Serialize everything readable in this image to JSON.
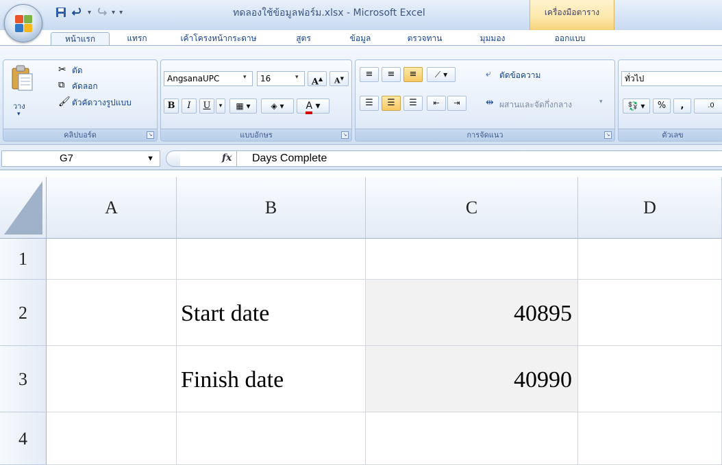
{
  "window": {
    "title": "ทดลองใช้ข้อมูลฟอร์ม.xlsx - Microsoft Excel",
    "contextual_tab": "เครื่องมือตาราง"
  },
  "quick_access": {
    "icons": [
      "save-icon",
      "undo-icon",
      "redo-icon",
      "customize-dropdown-icon"
    ]
  },
  "tabs": [
    {
      "label": "หน้าแรก",
      "active": true
    },
    {
      "label": "แทรก"
    },
    {
      "label": "เค้าโครงหน้ากระดาษ"
    },
    {
      "label": "สูตร"
    },
    {
      "label": "ข้อมูล"
    },
    {
      "label": "ตรวจทาน"
    },
    {
      "label": "มุมมอง"
    },
    {
      "label": "ออกแบบ"
    }
  ],
  "ribbon": {
    "clipboard": {
      "label": "คลิปบอร์ด",
      "paste": "วาง",
      "cut": "ตัด",
      "copy": "คัดลอก",
      "format_painter": "ตัวคัดวางรูปแบบ"
    },
    "font": {
      "label": "แบบอักษร",
      "font_name": "AngsanaUPC",
      "font_size": "16",
      "bold": "B",
      "italic": "I",
      "underline": "U"
    },
    "alignment": {
      "label": "การจัดแนว",
      "wrap_text": "ตัดข้อความ",
      "merge_center": "ผสานและจัดกึ่งกลาง"
    },
    "number": {
      "label": "ตัวเลข",
      "format": "ทั่วไป",
      "percent": "%",
      "comma": ","
    }
  },
  "formula_bar": {
    "name_box": "G7",
    "fx": "fx",
    "formula": "Days Complete"
  },
  "sheet": {
    "columns": [
      "A",
      "B",
      "C",
      "D"
    ],
    "rows": [
      "1",
      "2",
      "3",
      "4"
    ],
    "cells": {
      "B2": "Start date",
      "C2": "40895",
      "B3": "Finish date",
      "C3": "40990"
    }
  }
}
